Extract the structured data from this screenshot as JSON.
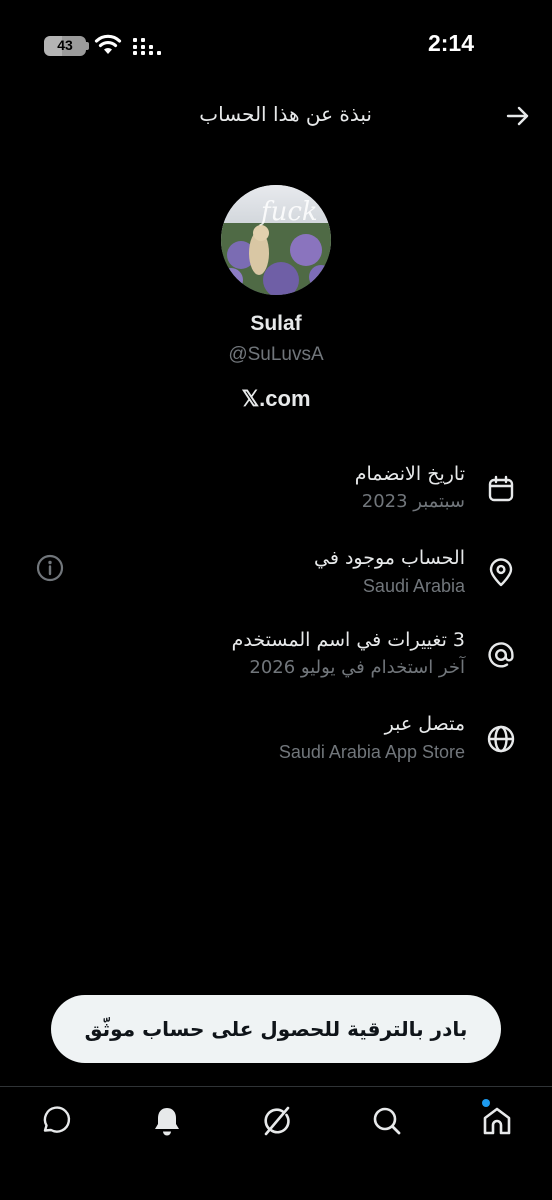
{
  "status_bar": {
    "time": "2:14",
    "battery_level": "43"
  },
  "header": {
    "title": "نبذة عن هذا الحساب"
  },
  "profile": {
    "avatar_caption": "fuck",
    "display_name": "Sulaf",
    "handle": "@SuLuvsA",
    "website": "𝕏.com"
  },
  "about": [
    {
      "icon": "calendar-icon",
      "title": "تاريخ الانضمام",
      "value": "سبتمبر 2023"
    },
    {
      "icon": "location-pin-icon",
      "title": "الحساب موجود في",
      "value": "Saudi Arabia"
    },
    {
      "icon": "at-sign-icon",
      "title": "3 تغييرات في اسم المستخدم",
      "value": "آخر استخدام في يوليو 2026"
    },
    {
      "icon": "globe-icon",
      "title": "متصل عبر",
      "value": "Saudi Arabia App Store"
    }
  ],
  "upgrade_button": {
    "label": "بادر بالترقية للحصول على حساب موثّق"
  },
  "bottom_nav": {
    "items": [
      "messages-icon",
      "notifications-bell-icon",
      "grok-icon",
      "search-icon",
      "home-icon"
    ],
    "active": "home-icon"
  },
  "colors": {
    "background": "#000000",
    "primary_text": "#e7e9ea",
    "secondary_text": "#71767b",
    "accent": "#1d9bf0",
    "button_bg": "#eff3f4"
  }
}
